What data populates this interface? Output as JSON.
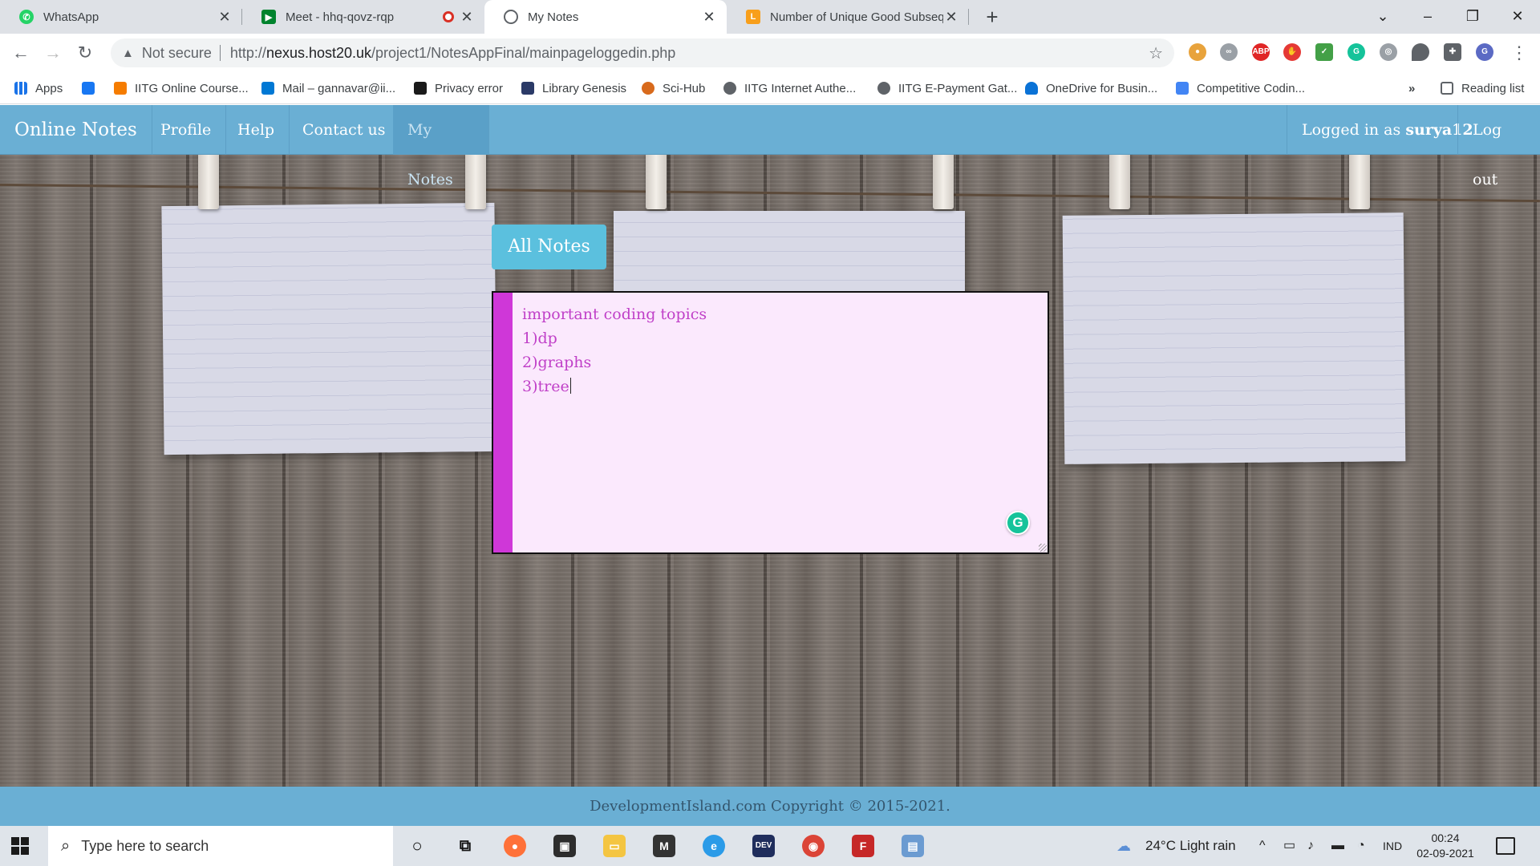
{
  "browser": {
    "tabs": [
      {
        "title": "WhatsApp",
        "icon": "whatsapp-icon",
        "active": false
      },
      {
        "title": "Meet - hhq-qovz-rqp",
        "icon": "google-meet-icon",
        "active": false
      },
      {
        "title": "My Notes",
        "icon": "globe-icon",
        "active": true
      },
      {
        "title": "Number of Unique Good Subseq",
        "icon": "leetcode-icon",
        "active": false
      }
    ],
    "address": {
      "security_label": "Not secure",
      "url_host": "nexus.host20.uk",
      "url_prefix": "http://",
      "url_path": "/project1/NotesAppFinal/mainpageloggedin.php"
    },
    "bookmarks": [
      "Apps",
      "IITG Online Course...",
      "Mail – gannavar@ii...",
      "Privacy error",
      "Library Genesis",
      "Sci-Hub",
      "IITG Internet Authe...",
      "IITG E-Payment Gat...",
      "OneDrive for Busin...",
      "Competitive Codin..."
    ],
    "reading_list": "Reading list",
    "overflow": "»",
    "profile_initial": "G"
  },
  "site": {
    "brand": "Online Notes",
    "nav": [
      "Profile",
      "Help",
      "Contact us",
      "My Notes"
    ],
    "logged_in_prefix": "Logged in as",
    "username": "surya12",
    "logout": "Log out",
    "all_notes_button": "All Notes",
    "note_text": "important coding topics\n1)dp\n2)graphs\n3)tree",
    "footer": "DevelopmentIsland.com Copyright © 2015-2021."
  },
  "taskbar": {
    "search_placeholder": "Type here to search",
    "weather": "24°C  Light rain",
    "language": "IND",
    "time": "00:24",
    "date": "02-09-2021"
  },
  "colors": {
    "navbar": "#6aafd4",
    "button": "#5bc0de",
    "note_stripe": "#cf37d8",
    "note_bg": "#fbe9fd",
    "note_text": "#c040c8"
  }
}
